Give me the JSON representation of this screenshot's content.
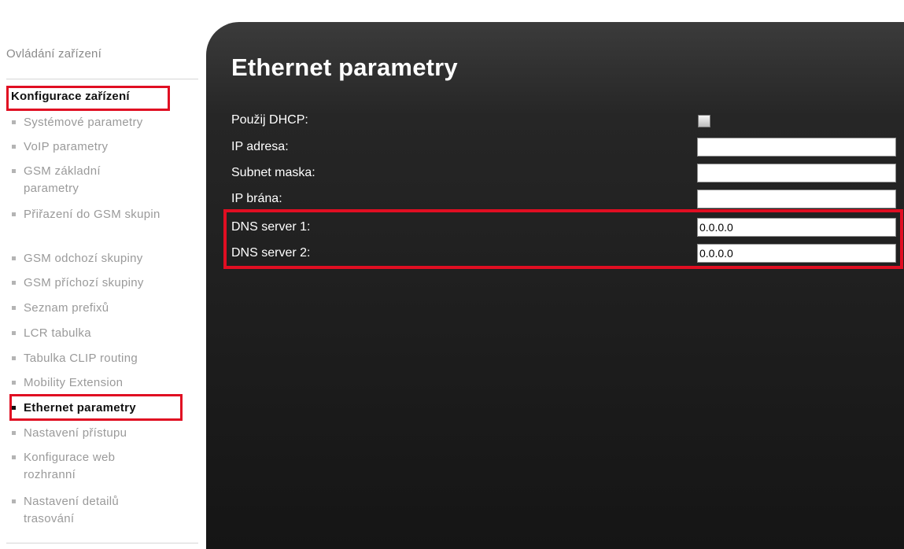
{
  "sidebar": {
    "header": "Ovládání zařízení",
    "section": "Konfigurace zařízení",
    "items": [
      "Systémové parametry",
      "VoIP parametry",
      "GSM základní parametry",
      "Přiřazení do GSM skupin",
      "GSM odchozí skupiny",
      "GSM příchozí skupiny",
      "Seznam prefixů",
      "LCR tabulka",
      "Tabulka CLIP routing",
      "Mobility Extension",
      "Ethernet parametry",
      "Nastavení přístupu",
      "Konfigurace web rozhranní",
      "Nastavení detailů trasování"
    ],
    "active_item": "Ethernet parametry"
  },
  "main": {
    "title": "Ethernet parametry",
    "fields": {
      "dhcp": {
        "label": "Použij DHCP:",
        "checked": false
      },
      "ip": {
        "label": "IP adresa:",
        "value": ""
      },
      "subnet": {
        "label": "Subnet maska:",
        "value": ""
      },
      "gateway": {
        "label": "IP brána:",
        "value": ""
      },
      "dns1": {
        "label": "DNS server 1:",
        "value": "0.0.0.0"
      },
      "dns2": {
        "label": "DNS server 2:",
        "value": "0.0.0.0"
      }
    }
  },
  "colors": {
    "highlight": "#e00e22",
    "panel": "#262626",
    "sidebar_inactive": "#9a9a9a",
    "sidebar_active": "#111111"
  }
}
